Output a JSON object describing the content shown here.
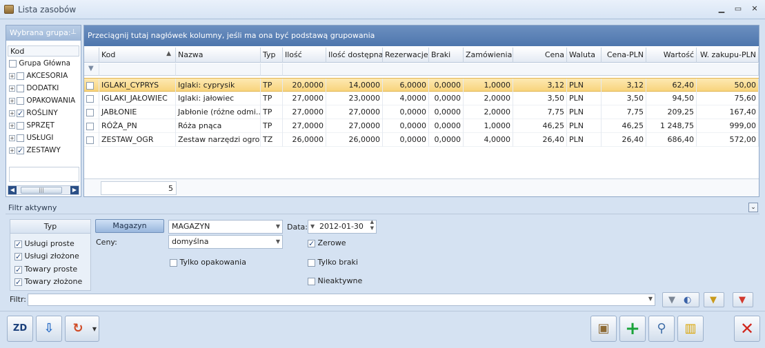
{
  "window": {
    "title": "Lista zasobów",
    "minimize": "▁",
    "maximize": "▭",
    "close": "✕"
  },
  "left_panel": {
    "header": "Wybrana grupa:",
    "kod_header": "Kod",
    "root": "Grupa Główna",
    "items": [
      {
        "label": "AKCESORIA",
        "checked": false
      },
      {
        "label": "DODATKI",
        "checked": false
      },
      {
        "label": "OPAKOWANIA",
        "checked": false
      },
      {
        "label": "ROŚLINY",
        "checked": true
      },
      {
        "label": "SPRZĘT",
        "checked": false
      },
      {
        "label": "USŁUGI",
        "checked": false
      },
      {
        "label": "ZESTAWY",
        "checked": true
      }
    ]
  },
  "grid": {
    "group_hint": "Przeciągnij tutaj nagłówek kolumny, jeśli ma ona być podstawą grupowania",
    "columns": [
      "Kod",
      "Nazwa",
      "Typ",
      "Ilość",
      "Ilość dostępna",
      "Rezerwacje",
      "Braki",
      "Zamówienia",
      "Cena",
      "Waluta",
      "Cena-PLN",
      "Wartość",
      "W. zakupu-PLN"
    ],
    "rows": [
      [
        "IGLAKI_CYPRYS",
        "Iglaki: cyprysik",
        "TP",
        "20,0000",
        "14,0000",
        "6,0000",
        "0,0000",
        "1,0000",
        "3,12",
        "PLN",
        "3,12",
        "62,40",
        "50,00"
      ],
      [
        "IGLAKI_JAŁOWIEC",
        "Iglaki: jałowiec",
        "TP",
        "27,0000",
        "23,0000",
        "4,0000",
        "0,0000",
        "2,0000",
        "3,50",
        "PLN",
        "3,50",
        "94,50",
        "75,60"
      ],
      [
        "JABŁONIE",
        "Jabłonie (różne odmi...",
        "TP",
        "27,0000",
        "27,0000",
        "0,0000",
        "0,0000",
        "2,0000",
        "7,75",
        "PLN",
        "7,75",
        "209,25",
        "167,40"
      ],
      [
        "RÓŻA_PN",
        "Róża pnąca",
        "TP",
        "27,0000",
        "27,0000",
        "0,0000",
        "0,0000",
        "1,0000",
        "46,25",
        "PLN",
        "46,25",
        "1 248,75",
        "999,00"
      ],
      [
        "ZESTAW_OGR",
        "Zestaw narzędzi ogro...",
        "TZ",
        "26,0000",
        "26,0000",
        "0,0000",
        "0,0000",
        "4,0000",
        "26,40",
        "PLN",
        "26,40",
        "686,40",
        "572,00"
      ]
    ],
    "count": "5"
  },
  "filter": {
    "title": "Filtr aktywny",
    "typ_header": "Typ",
    "types": [
      {
        "label": "Usługi proste",
        "checked": true
      },
      {
        "label": "Usługi złożone",
        "checked": true
      },
      {
        "label": "Towary proste",
        "checked": true
      },
      {
        "label": "Towary złożone",
        "checked": true
      }
    ],
    "magazyn_button": "Magazyn",
    "magazyn_value": "MAGAZYN",
    "ceny_label": "Ceny:",
    "ceny_value": "domyślna",
    "data_label": "Data:",
    "data_value": "2012-01-30",
    "tylko_opakowania": {
      "label": "Tylko opakowania",
      "checked": false
    },
    "zerowe": {
      "label": "Zerowe",
      "checked": true
    },
    "tylko_braki": {
      "label": "Tylko braki",
      "checked": false
    },
    "nieaktywne": {
      "label": "Nieaktywne",
      "checked": false
    },
    "filtr_label": "Filtr:"
  },
  "toolbar": {
    "zd_label": "ZD"
  },
  "colors": {
    "accent": "#4e76ad",
    "selected_row": "#f8d47c"
  }
}
